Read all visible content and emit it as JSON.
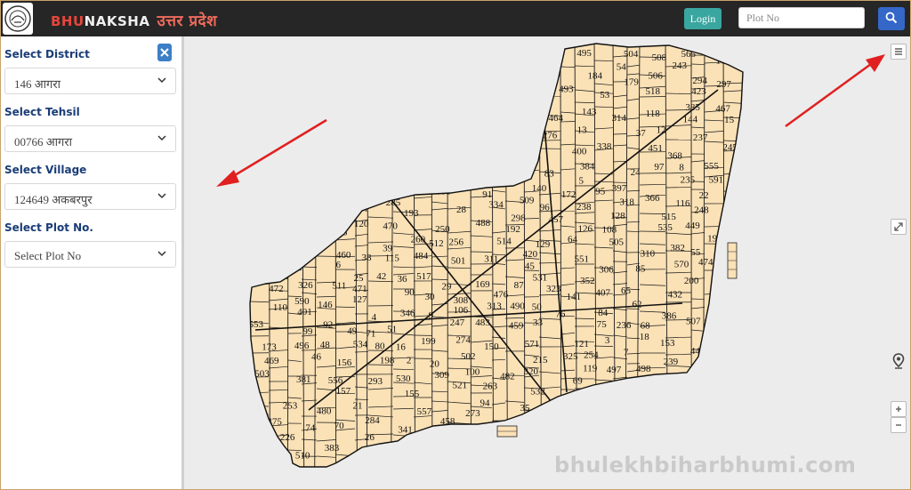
{
  "header": {
    "brand_left": "BHU",
    "brand_right": "NAKSHA",
    "state": "उत्तर प्रदेश",
    "login_label": "Login",
    "plot_placeholder": "Plot No"
  },
  "sidebar": {
    "district_label": "Select District",
    "district_value": "146 आगरा",
    "tehsil_label": "Select Tehsil",
    "tehsil_value": "00766 आगरा",
    "village_label": "Select Village",
    "village_value": "124649 अकबरपुर",
    "plot_label": "Select Plot No.",
    "plot_value": "Select Plot No"
  },
  "map": {
    "parcel_color": "#fae1b6",
    "plot_numbers": [
      "515",
      "514",
      "534",
      "532",
      "531",
      "530",
      "571",
      "570",
      "590",
      "591",
      "565",
      "555",
      "556",
      "557",
      "553",
      "551",
      "535",
      "521",
      "518",
      "517",
      "512",
      "511",
      "510",
      "509",
      "386",
      "385",
      "383",
      "384",
      "366",
      "382",
      "381",
      "368",
      "397",
      "346",
      "314",
      "313",
      "311",
      "310",
      "318",
      "326",
      "338",
      "341",
      "352",
      "501",
      "502",
      "503",
      "504",
      "505",
      "506",
      "507",
      "508",
      "498",
      "497",
      "496",
      "484",
      "482",
      "483",
      "480",
      "476",
      "475",
      "486",
      "488",
      "490",
      "493",
      "495",
      "334",
      "325",
      "323",
      "309",
      "320",
      "260",
      "263",
      "256",
      "254",
      "253",
      "250",
      "248",
      "247",
      "245",
      "243",
      "273",
      "276",
      "274",
      "285",
      "284",
      "293",
      "294",
      "297",
      "298",
      "306",
      "308",
      "173",
      "172",
      "181",
      "184",
      "239",
      "238",
      "237",
      "236",
      "235",
      "226",
      "215",
      "200",
      "199",
      "198",
      "197",
      "193",
      "192",
      "179",
      "169",
      "157",
      "156",
      "155",
      "153",
      "150",
      "146",
      "144",
      "143",
      "141",
      "140",
      "129",
      "128",
      "127",
      "126",
      "121",
      "120",
      "119",
      "118",
      "116",
      "115",
      "110",
      "108",
      "106",
      "104",
      "100",
      "99",
      "98",
      "97",
      "96",
      "95",
      "94",
      "92",
      "91",
      "90",
      "87",
      "85",
      "84",
      "83",
      "80",
      "76",
      "75",
      "74",
      "71",
      "70",
      "69",
      "68",
      "65",
      "64",
      "62",
      "55",
      "54",
      "53",
      "51",
      "50",
      "49",
      "48",
      "46",
      "45",
      "42",
      "39",
      "38",
      "37",
      "36",
      "35",
      "33",
      "31",
      "30",
      "29",
      "28",
      "25",
      "24",
      "22",
      "21",
      "20",
      "18",
      "16",
      "15",
      "13",
      "12",
      "9",
      "8",
      "7",
      "6",
      "5",
      "4",
      "3",
      "2",
      "26",
      "467",
      "472",
      "471",
      "470",
      "469",
      "474",
      "464",
      "460",
      "459",
      "458",
      "457",
      "451",
      "449",
      "448",
      "432",
      "423",
      "420",
      "407",
      "401",
      "400"
    ]
  },
  "watermark": "bhulekhbiharbhumi.com",
  "icons": {
    "close": "close-icon",
    "search": "search-icon",
    "layers": "menu-icon",
    "fullscreen": "expand-icon",
    "locate": "location-pin-icon",
    "zoom_in": "plus-icon",
    "zoom_out": "minus-icon"
  },
  "colors": {
    "topbar": "#262626",
    "accent_blue": "#3567c9",
    "login": "#3aa6a0",
    "label": "#1a3d77",
    "arrow": "#e02020"
  }
}
